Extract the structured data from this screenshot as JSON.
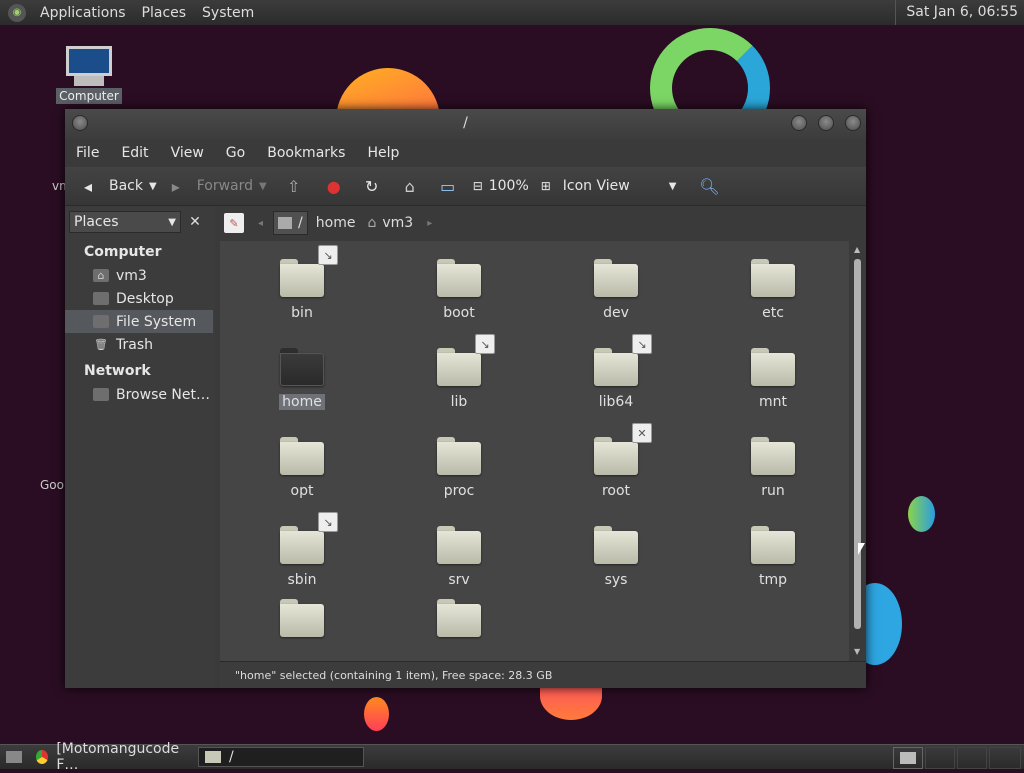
{
  "top_panel": {
    "menus": [
      "Applications",
      "Places",
      "System"
    ],
    "clock": "Sat Jan  6, 06:55"
  },
  "desktop": {
    "computer_label": "Computer",
    "partial_label_1": "vm",
    "partial_label_2": "Goo"
  },
  "window": {
    "title": "/",
    "menu": [
      "File",
      "Edit",
      "View",
      "Go",
      "Bookmarks",
      "Help"
    ],
    "toolbar": {
      "back": "Back",
      "forward": "Forward",
      "zoom": "100%",
      "view_mode": "Icon View"
    },
    "sidebar": {
      "combo": "Places",
      "sections": [
        {
          "title": "Computer",
          "items": [
            "vm3",
            "Desktop",
            "File System",
            "Trash"
          ]
        },
        {
          "title": "Network",
          "items": [
            "Browse Net…"
          ]
        }
      ],
      "selected": "File System"
    },
    "pathbar": [
      "/",
      "home",
      "vm3"
    ],
    "folders": [
      {
        "name": "bin",
        "emblem": "link"
      },
      {
        "name": "boot",
        "emblem": ""
      },
      {
        "name": "dev",
        "emblem": ""
      },
      {
        "name": "etc",
        "emblem": ""
      },
      {
        "name": "home",
        "emblem": "",
        "selected": true
      },
      {
        "name": "lib",
        "emblem": "link"
      },
      {
        "name": "lib64",
        "emblem": "link"
      },
      {
        "name": "mnt",
        "emblem": ""
      },
      {
        "name": "opt",
        "emblem": ""
      },
      {
        "name": "proc",
        "emblem": ""
      },
      {
        "name": "root",
        "emblem": "noaccess"
      },
      {
        "name": "run",
        "emblem": ""
      },
      {
        "name": "sbin",
        "emblem": "link"
      },
      {
        "name": "srv",
        "emblem": ""
      },
      {
        "name": "sys",
        "emblem": ""
      },
      {
        "name": "tmp",
        "emblem": ""
      },
      {
        "name": "",
        "emblem": ""
      },
      {
        "name": "",
        "emblem": ""
      }
    ],
    "status": "\"home\" selected (containing 1 item), Free space: 28.3 GB"
  },
  "taskbar": {
    "tasks": [
      "[Motomangucode F…",
      "/"
    ]
  }
}
